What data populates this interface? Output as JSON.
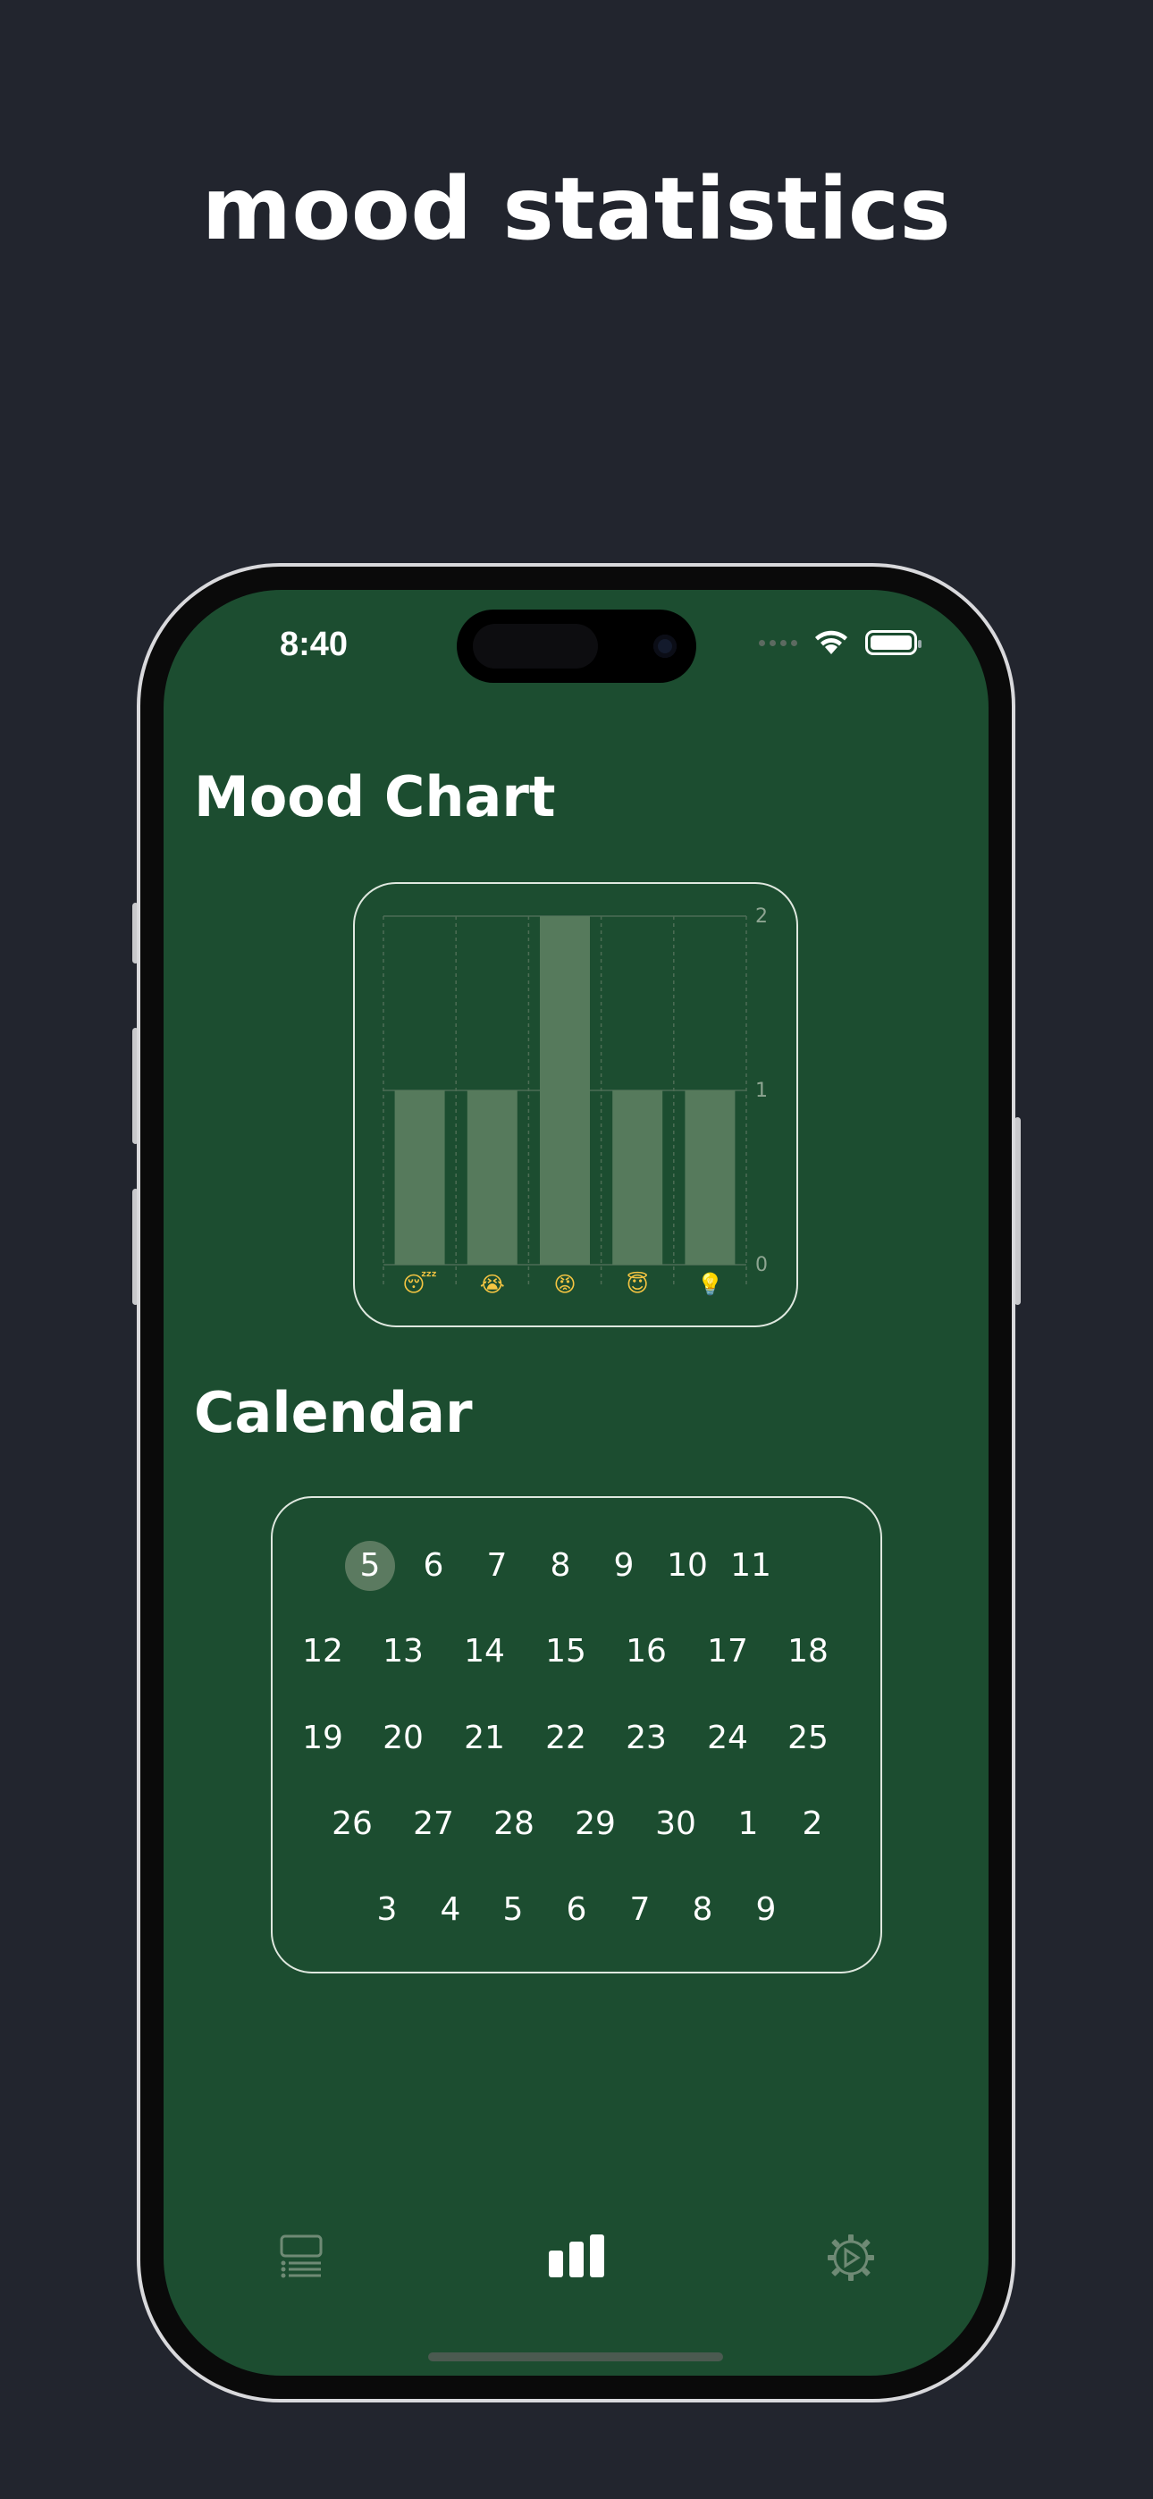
{
  "promo": {
    "headline": "mood statistics"
  },
  "status_bar": {
    "time": "8:40"
  },
  "mood_chart": {
    "title": "Mood Chart"
  },
  "chart_data": {
    "type": "bar",
    "categories": [
      "😴",
      "😭",
      "😡",
      "😇",
      "💡"
    ],
    "values": [
      1,
      1,
      2,
      1,
      1
    ],
    "y_ticks": [
      "0",
      "1",
      "2"
    ],
    "ylim": [
      0,
      2
    ],
    "grid": true,
    "bar_color": "#567a5c"
  },
  "calendar": {
    "title": "Calendar",
    "selected_day": "5",
    "weeks": [
      [
        "5",
        "6",
        "7",
        "8",
        "9",
        "10",
        "11"
      ],
      [
        "12",
        "13",
        "14",
        "15",
        "16",
        "17",
        "18"
      ],
      [
        "19",
        "20",
        "21",
        "22",
        "23",
        "24",
        "25"
      ],
      [
        "26",
        "27",
        "28",
        "29",
        "30",
        "1",
        "2"
      ],
      [
        "3",
        "4",
        "5",
        "6",
        "7",
        "8",
        "9"
      ]
    ]
  },
  "tab_bar": {
    "tabs": [
      {
        "icon": "list-icon",
        "active": false
      },
      {
        "icon": "bar-chart-icon",
        "active": true
      },
      {
        "icon": "gear-icon",
        "active": false
      }
    ]
  },
  "colors": {
    "background": "#22252e",
    "screen": "#1c4d30",
    "bar": "#567a5c",
    "accent_selected": "#5b7a60"
  }
}
